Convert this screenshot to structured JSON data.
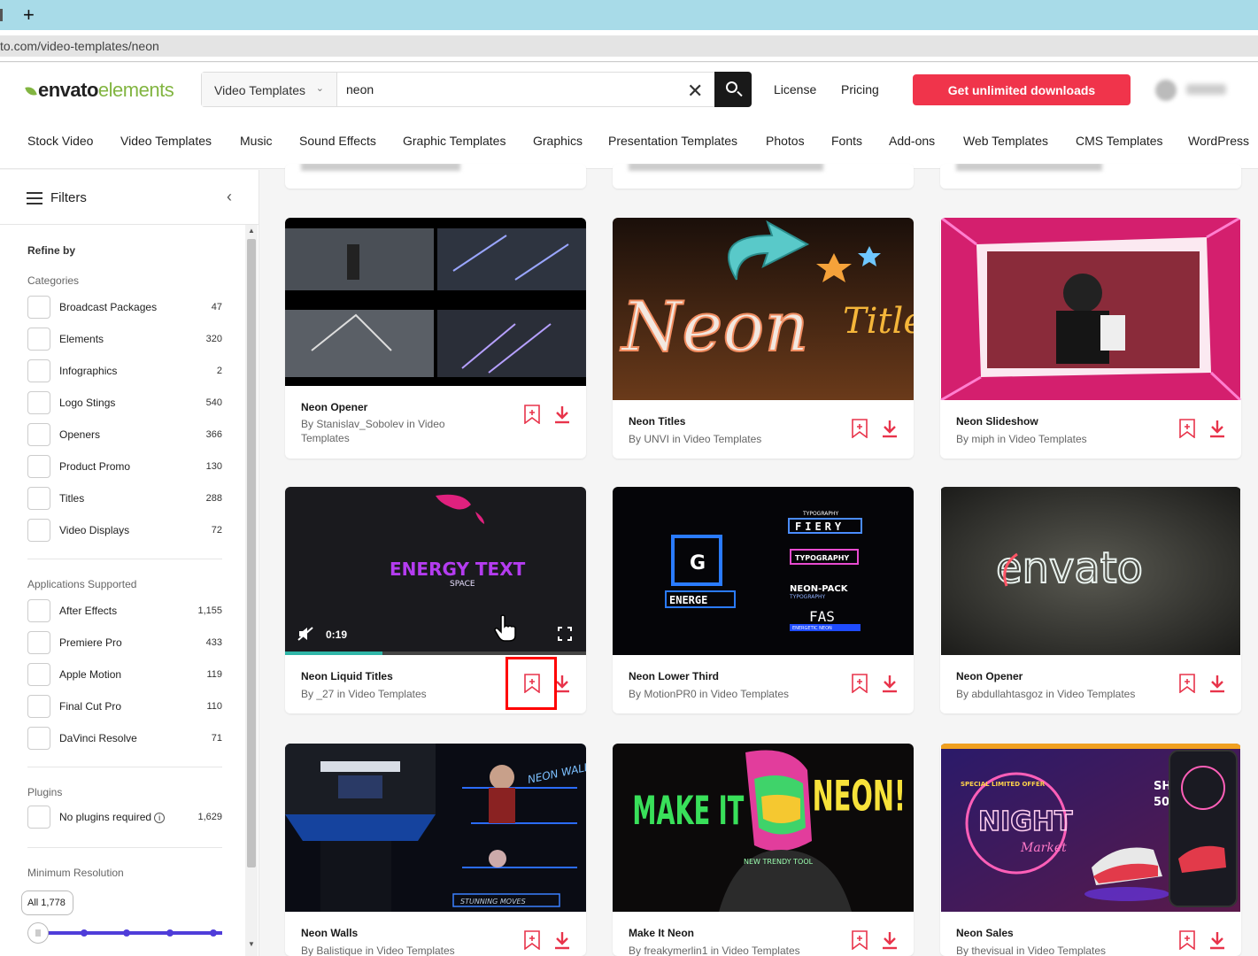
{
  "browser": {
    "new_tab_glyph": "+",
    "url": "to.com/video-templates/neon"
  },
  "header": {
    "logo_word1": "envato",
    "logo_word2": "elements",
    "category_select": "Video Templates",
    "search_value": "neon",
    "clear_glyph": "✕",
    "links": [
      "License",
      "Pricing"
    ],
    "cta": "Get unlimited downloads",
    "nav": [
      "Stock Video",
      "Video Templates",
      "Music",
      "Sound Effects",
      "Graphic Templates",
      "Graphics",
      "Presentation Templates",
      "Photos",
      "Fonts",
      "Add-ons",
      "Web Templates",
      "CMS Templates",
      "WordPress"
    ]
  },
  "sidebar": {
    "title": "Filters",
    "collapse_glyph": "‹",
    "refine_by": "Refine by",
    "sections": {
      "categories": {
        "title": "Categories",
        "items": [
          {
            "label": "Broadcast Packages",
            "count": "47"
          },
          {
            "label": "Elements",
            "count": "320"
          },
          {
            "label": "Infographics",
            "count": "2"
          },
          {
            "label": "Logo Stings",
            "count": "540"
          },
          {
            "label": "Openers",
            "count": "366"
          },
          {
            "label": "Product Promo",
            "count": "130"
          },
          {
            "label": "Titles",
            "count": "288"
          },
          {
            "label": "Video Displays",
            "count": "72"
          }
        ]
      },
      "applications": {
        "title": "Applications Supported",
        "items": [
          {
            "label": "After Effects",
            "count": "1,155"
          },
          {
            "label": "Premiere Pro",
            "count": "433"
          },
          {
            "label": "Apple Motion",
            "count": "119"
          },
          {
            "label": "Final Cut Pro",
            "count": "110"
          },
          {
            "label": "DaVinci Resolve",
            "count": "71"
          }
        ]
      },
      "plugins": {
        "title": "Plugins",
        "items": [
          {
            "label": "No plugins required",
            "count": "1,629"
          }
        ]
      },
      "resolution": {
        "title": "Minimum Resolution",
        "pill": "All 1,778"
      }
    }
  },
  "cards": [
    {
      "title": "Neon Opener",
      "by": "By Stanislav_Sobolev in Video Templates"
    },
    {
      "title": "Neon Titles",
      "by": "By UNVI in Video Templates"
    },
    {
      "title": "Neon Slideshow",
      "by": "By miph in Video Templates"
    },
    {
      "title": "Neon Liquid Titles",
      "by": "By _27 in Video Templates",
      "time": "0:19"
    },
    {
      "title": "Neon Lower Third",
      "by": "By MotionPR0 in Video Templates"
    },
    {
      "title": "Neon Opener",
      "by": "By abdullahtasgoz in Video Templates"
    },
    {
      "title": "Neon Walls",
      "by": "By Balistique in Video Templates"
    },
    {
      "title": "Make It Neon",
      "by": "By freakymerlin1 in Video Templates"
    },
    {
      "title": "Neon Sales",
      "by": "By thevisual in Video Templates"
    }
  ],
  "thumb_text": {
    "c4_title": "ENERGY TEXT",
    "c4_sub": "SPACE",
    "c5_logo": "G",
    "c5_logo_word": "ENERGE",
    "c5_list": [
      "TYPOGRAPHY",
      "FIERY",
      "TYPOGRAPHY",
      "NEON-PACK",
      "TYPOGRAPHY",
      "FAS",
      "ENERGETIC NEON"
    ],
    "c6_word": "envato",
    "c2_word": "Neon",
    "c2_word2": "Title",
    "c8_left": "MAKE IT",
    "c8_right": "NEON!",
    "c8_small": "NEW TRENDY TOOL",
    "c7_tag": "NEON WALLS",
    "c7_bottom": "STUNNING MOVES",
    "c9_badge": "SPECIAL LIMITED OFFER",
    "c9_main": "NIGHT",
    "c9_sub": "Market",
    "c9_sh": "SH",
    "c9_num": "50"
  },
  "colors": {
    "brand_red": "#f0344b",
    "brand_green": "#82b541",
    "slider": "#4f3dd9",
    "highlight": "#ff0000"
  },
  "icons": [
    "plus-icon",
    "search-icon",
    "close-icon",
    "filters-icon",
    "bookmark-add-icon",
    "download-icon",
    "mute-icon",
    "fullscreen-icon",
    "pointer-hand-icon",
    "info-icon"
  ]
}
